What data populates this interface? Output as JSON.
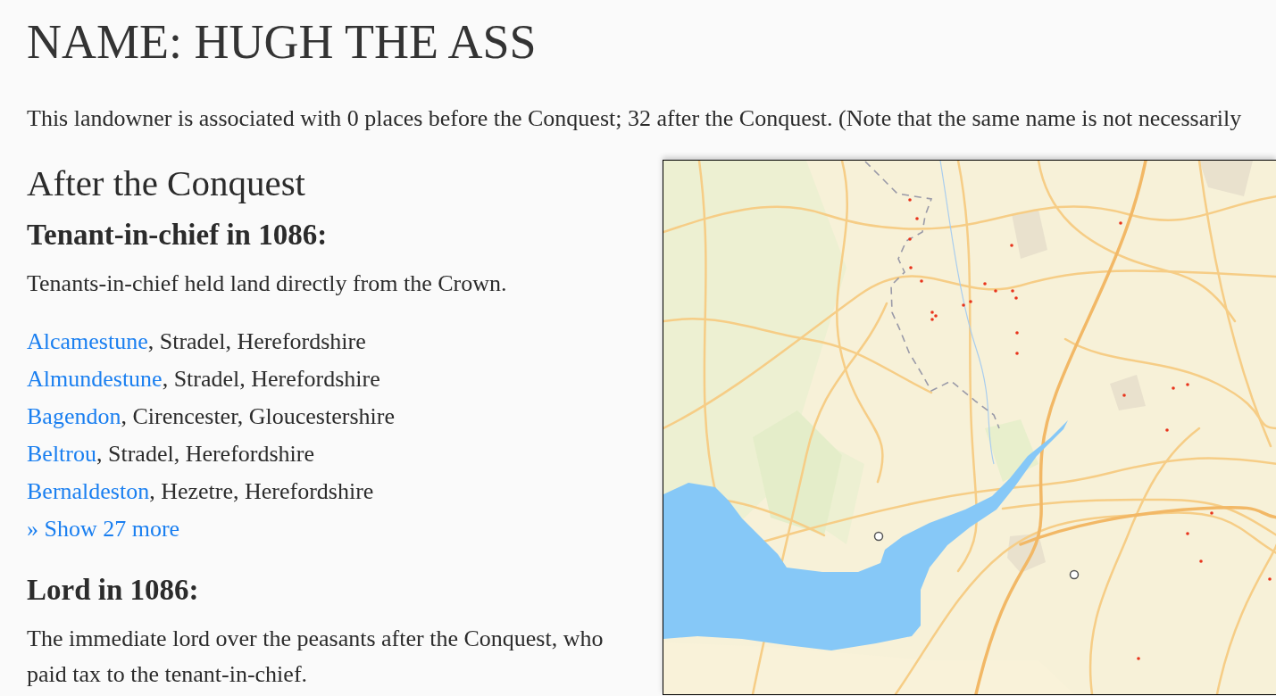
{
  "title": "NAME: HUGH THE ASS",
  "summary": "This landowner is associated with 0 places before the Conquest; 32 after the Conquest. (Note that the same name is not necessarily",
  "section": {
    "heading": "After the Conquest",
    "groups": [
      {
        "heading": "Tenant-in-chief in 1086:",
        "description": "Tenants-in-chief held land directly from the Crown.",
        "places": [
          {
            "name": "Alcamestune",
            "location": ", Stradel, Herefordshire"
          },
          {
            "name": "Almundestune",
            "location": ", Stradel, Herefordshire"
          },
          {
            "name": "Bagendon",
            "location": ", Cirencester, Gloucestershire"
          },
          {
            "name": "Beltrou",
            "location": ", Stradel, Herefordshire"
          },
          {
            "name": "Bernaldeston",
            "location": ", Hezetre, Herefordshire"
          }
        ],
        "show_more": "» Show 27 more"
      },
      {
        "heading": "Lord in 1086:",
        "description": "The immediate lord over the peasants after the Conquest, who paid tax to the tenant-in-chief."
      }
    ]
  }
}
